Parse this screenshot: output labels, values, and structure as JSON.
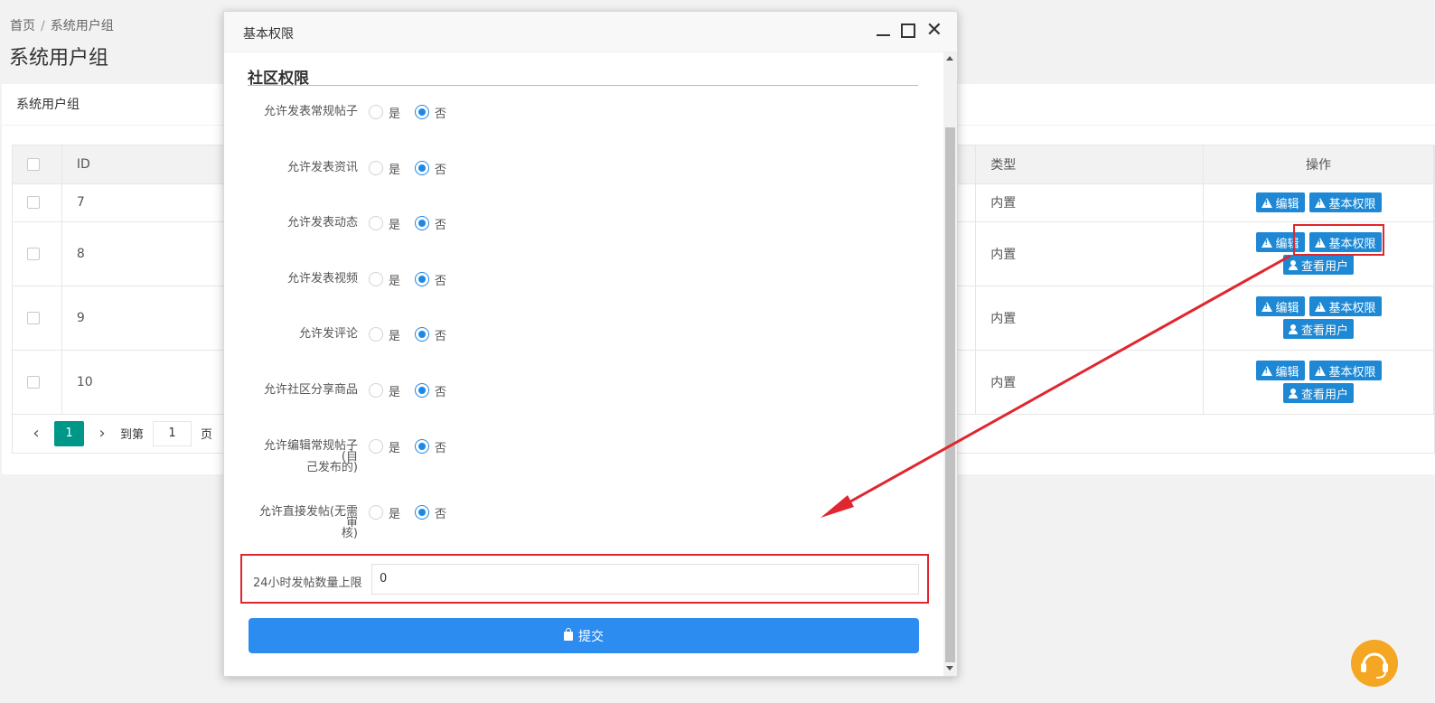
{
  "breadcrumb": {
    "home": "首页",
    "sep": "/",
    "current": "系统用户组"
  },
  "page_title": "系统用户组",
  "card_title": "系统用户组",
  "table": {
    "headers": {
      "id": "ID",
      "type": "类型",
      "ops": "操作"
    },
    "rows": [
      {
        "id": "7",
        "type": "内置"
      },
      {
        "id": "8",
        "type": "内置"
      },
      {
        "id": "9",
        "type": "内置"
      },
      {
        "id": "10",
        "type": "内置"
      }
    ],
    "buttons": {
      "edit": "编辑",
      "perm": "基本权限",
      "view_users": "查看用户"
    }
  },
  "pager": {
    "current": "1",
    "goto_label": "到第",
    "goto_value": "1",
    "page_suffix": "页"
  },
  "modal": {
    "title": "基本权限",
    "section_title": "社区权限",
    "yes": "是",
    "no": "否",
    "rows": [
      {
        "label": "允许发表常规帖子",
        "selected": "否"
      },
      {
        "label": "允许发表资讯",
        "selected": "否"
      },
      {
        "label": "允许发表动态",
        "selected": "否"
      },
      {
        "label": "允许发表视频",
        "selected": "否"
      },
      {
        "label": "允许发评论",
        "selected": "否"
      },
      {
        "label": "允许社区分享商品",
        "selected": "否"
      },
      {
        "label_line1": "允许编辑常规帖子(自",
        "label_line2": "己发布的)",
        "selected": "否"
      },
      {
        "label_line1": "允许直接发帖(无需审",
        "label_line2": "核)",
        "selected": "否"
      }
    ],
    "limit_label": "24小时发帖数量上限",
    "limit_value": "0",
    "submit": "提交"
  },
  "colors": {
    "accent": "#1e88d4",
    "highlight": "#e0262f",
    "pager_active": "#009688"
  }
}
